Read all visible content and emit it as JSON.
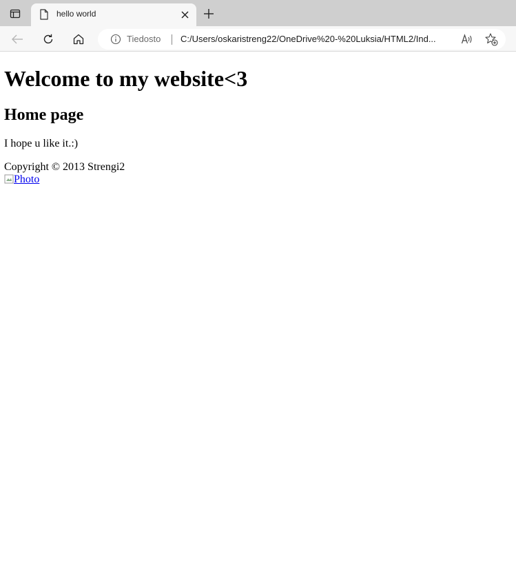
{
  "browser": {
    "tab": {
      "title": "hello world"
    },
    "addressbar": {
      "site_label": "Tiedosto",
      "url": "C:/Users/oskaristreng22/OneDrive%20-%20Luksia/HTML2/Ind..."
    },
    "icons": {
      "tab_actions": "tab-actions-icon",
      "page": "page-icon",
      "close": "close-icon",
      "new_tab": "plus-icon",
      "back": "back-arrow-icon",
      "refresh": "refresh-icon",
      "home": "home-icon",
      "info": "info-icon",
      "read_aloud": "read-aloud-icon",
      "favorites": "add-favorite-icon"
    },
    "colors": {
      "tabstrip": "#cfcfcf",
      "toolbar": "#f7f7f7",
      "link": "#0000ee"
    }
  },
  "page": {
    "heading": "Welcome to my website<3",
    "subheading": "Home page",
    "intro": "I hope u like it.:)",
    "copyright": "Copyright © 2013 Strengi2",
    "photo_alt": "Photo"
  }
}
